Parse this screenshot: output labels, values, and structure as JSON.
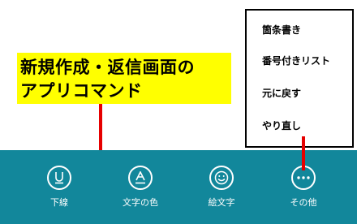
{
  "callout": {
    "line1": "新規作成・返信画面の",
    "line2": "アプリコマンド",
    "background": "#ffff00"
  },
  "app_bar": {
    "background": "#12879b",
    "commands": [
      {
        "label": "下線",
        "icon": "underline-icon"
      },
      {
        "label": "文字の色",
        "icon": "text-color-icon"
      },
      {
        "label": "絵文字",
        "icon": "emoji-icon"
      },
      {
        "label": "その他",
        "icon": "more-icon"
      }
    ]
  },
  "more_menu": {
    "items": [
      "箇条書き",
      "番号付きリスト",
      "元に戻す",
      "やり直し"
    ]
  },
  "pointer_color": "#e60000"
}
